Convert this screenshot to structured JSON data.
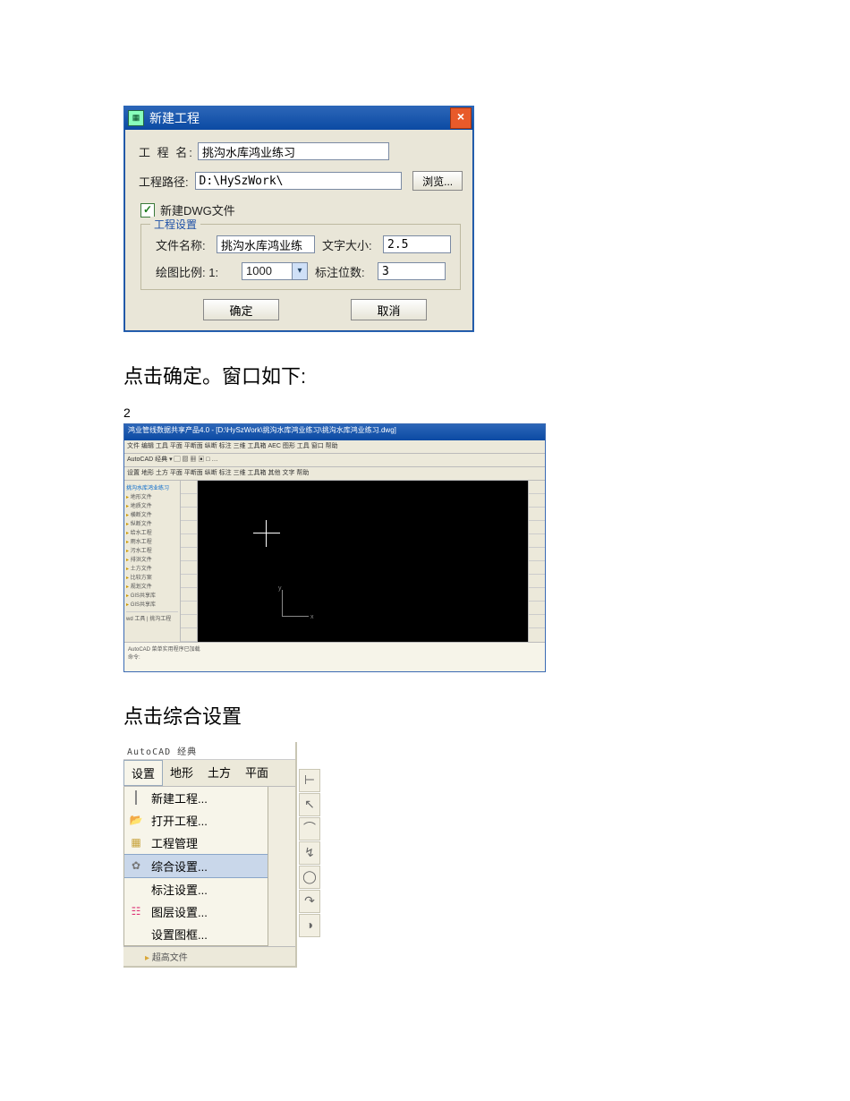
{
  "dialog1": {
    "title": "新建工程",
    "project_name_label": "工 程 名:",
    "project_name_value": "挑沟水库鸿业练习",
    "project_path_label": "工程路径:",
    "project_path_value": "D:\\HySzWork\\",
    "browse": "浏览...",
    "new_dwg_checkbox": "新建DWG文件",
    "group_title": "工程设置",
    "file_name_label": "文件名称:",
    "file_name_value": "挑沟水库鸿业练",
    "text_size_label": "文字大小:",
    "text_size_value": "2.5",
    "scale_label_prefix": "绘图比例: 1:",
    "scale_value": "1000",
    "precision_label": "标注位数:",
    "precision_value": "3",
    "ok": "确定",
    "cancel": "取消"
  },
  "text1": "点击确定。窗口如下:",
  "pagenum": "2",
  "cad": {
    "title": "鸿业管线数据共享产品4.0 - [D:\\HySzWork\\挑沟水库鸿业练习\\挑沟水库鸿业练习.dwg]",
    "menu": "文件 编辑 工具 平面 平断面 纵断 标注 三维 工具箱 AEC 图形 工具 窗口 帮助",
    "toolbar1": "AutoCAD 经典      ▾ ▢ ▨ ▦  ▣ □ …",
    "toolbar2": "设置 地形 土方 平面 平断面 纵断 标注 三维 工具箱 其他 文字 帮助",
    "tree_root": "挑沟水库鸿业练习",
    "tree_items": [
      "地形文件",
      "地质文件",
      "横断文件",
      "纵断文件",
      "给水工程",
      "雨水工程",
      "污水工程",
      "排洪文件",
      "土方文件",
      "比较方案",
      "规划文件",
      "GIS共享库",
      "GIS共享库"
    ],
    "tree_footer": "wd 工具 | 挑沟工程",
    "cmd_line1": "AutoCAD 菜单实用程序已加载",
    "cmd_line2": "命令:",
    "ucs_x": "x",
    "ucs_y": "y"
  },
  "text2": "点击综合设置",
  "menu": {
    "top": "AutoCAD 经典",
    "tabs": [
      "设置",
      "地形",
      "土方",
      "平面"
    ],
    "items": [
      {
        "label": "新建工程...",
        "icon": "new"
      },
      {
        "label": "打开工程...",
        "icon": "open"
      },
      {
        "label": "工程管理",
        "icon": "mgr"
      },
      {
        "label": "综合设置...",
        "icon": "gear",
        "selected": true
      },
      {
        "label": "标注设置...",
        "icon": ""
      },
      {
        "label": "图层设置...",
        "icon": "layer"
      },
      {
        "label": "设置图框...",
        "icon": ""
      }
    ],
    "bottom_item": "超高文件"
  }
}
